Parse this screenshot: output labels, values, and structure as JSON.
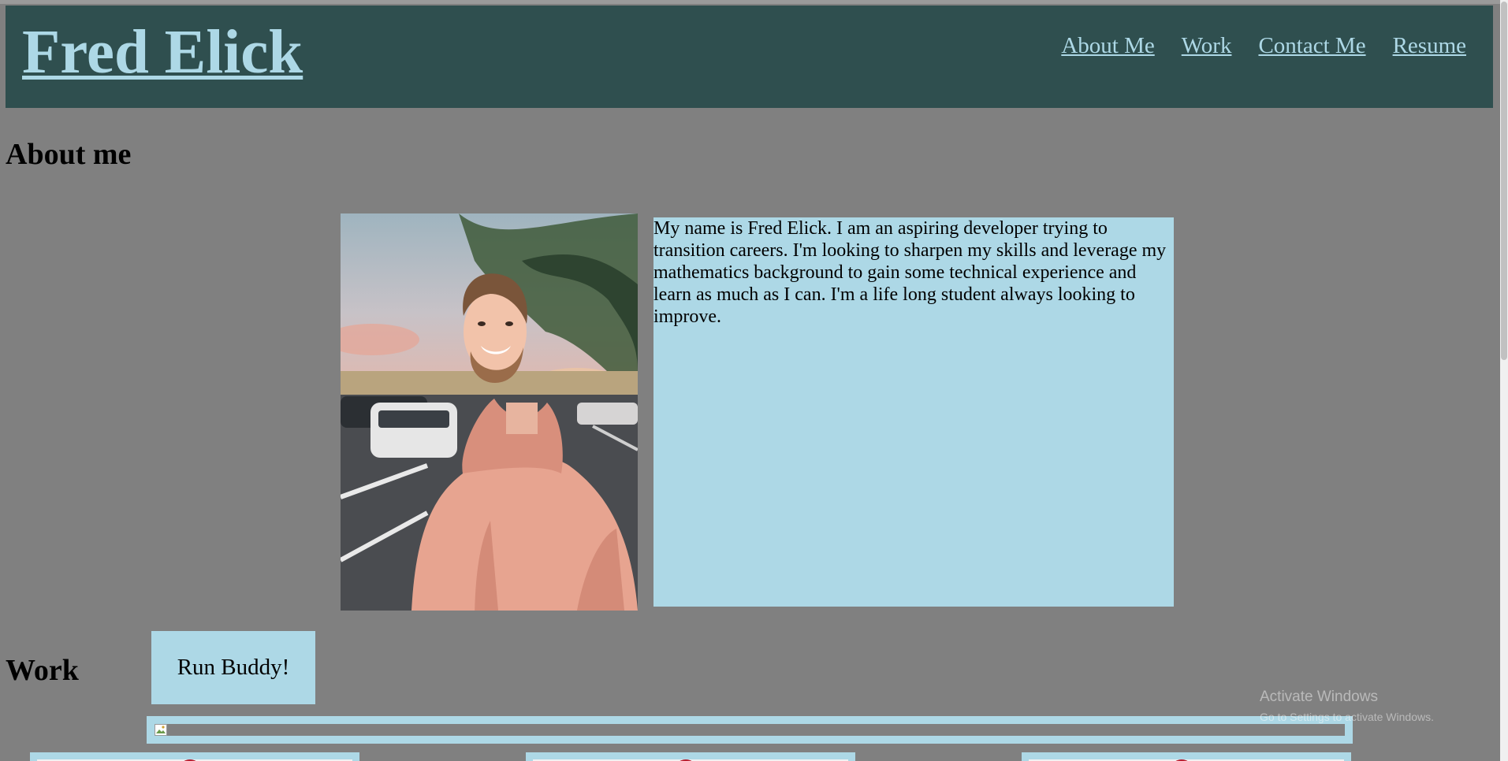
{
  "header": {
    "site_title": "Fred Elick",
    "background_color": "#2f4f4f",
    "link_color": "#add8e6",
    "nav": [
      {
        "label": "About Me"
      },
      {
        "label": "Work"
      },
      {
        "label": "Contact Me"
      },
      {
        "label": "Resume"
      }
    ]
  },
  "about": {
    "heading": "About me",
    "bio": "My name is Fred Elick. I am an aspiring developer trying to transition careers. I'm looking to sharpen my skills and leverage my mathematics background to gain some technical experience and learn as much as I can. I'm a life long student always looking to improve.",
    "photo_icon": "profile-photo"
  },
  "work": {
    "heading": "Work",
    "project_button": "Run Buddy!",
    "broken_image_icon": "broken-image-icon"
  },
  "os_overlay": {
    "title": "Activate Windows",
    "subtitle": "Go to Settings to activate Windows."
  },
  "colors": {
    "page_background": "#808080",
    "panel_background": "#add8e6"
  }
}
